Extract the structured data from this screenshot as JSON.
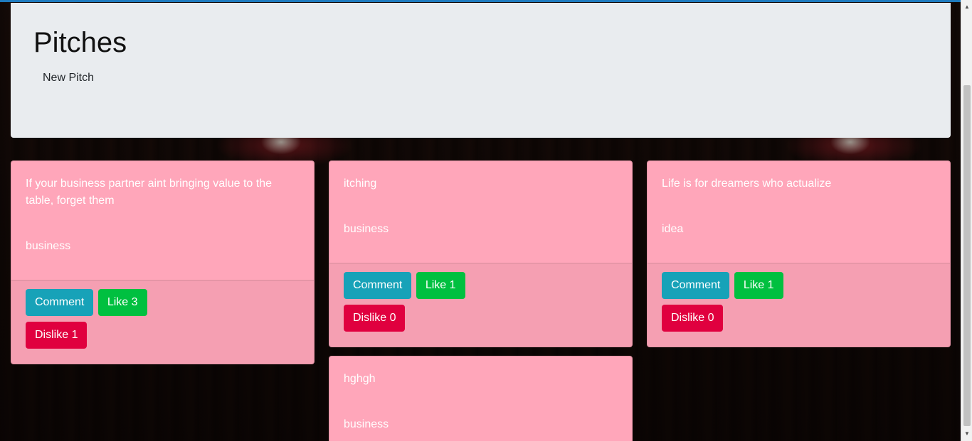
{
  "header": {
    "title": "Pitches",
    "new_pitch_label": "New Pitch"
  },
  "pitches": [
    {
      "text": "If your business partner aint bringing value to the table, forget them",
      "category": "business",
      "comment_label": "Comment",
      "like_label": "Like 3",
      "dislike_label": "Dislike 1"
    },
    {
      "text": "itching",
      "category": "business",
      "comment_label": "Comment",
      "like_label": "Like 1",
      "dislike_label": "Dislike 0"
    },
    {
      "text": "Life is for dreamers who actualize",
      "category": "idea",
      "comment_label": "Comment",
      "like_label": "Like 1",
      "dislike_label": "Dislike 0"
    },
    {
      "text": "hghgh",
      "category": "business"
    }
  ],
  "colors": {
    "card_background": "#ffa6ba",
    "comment_button": "#17a2b8",
    "like_button": "#00c040",
    "dislike_button": "#e0003f",
    "jumbotron": "#e9ecef"
  },
  "icons": {
    "scroll_up": "scroll-up-arrow-icon",
    "scroll_down": "scroll-down-arrow-icon"
  }
}
